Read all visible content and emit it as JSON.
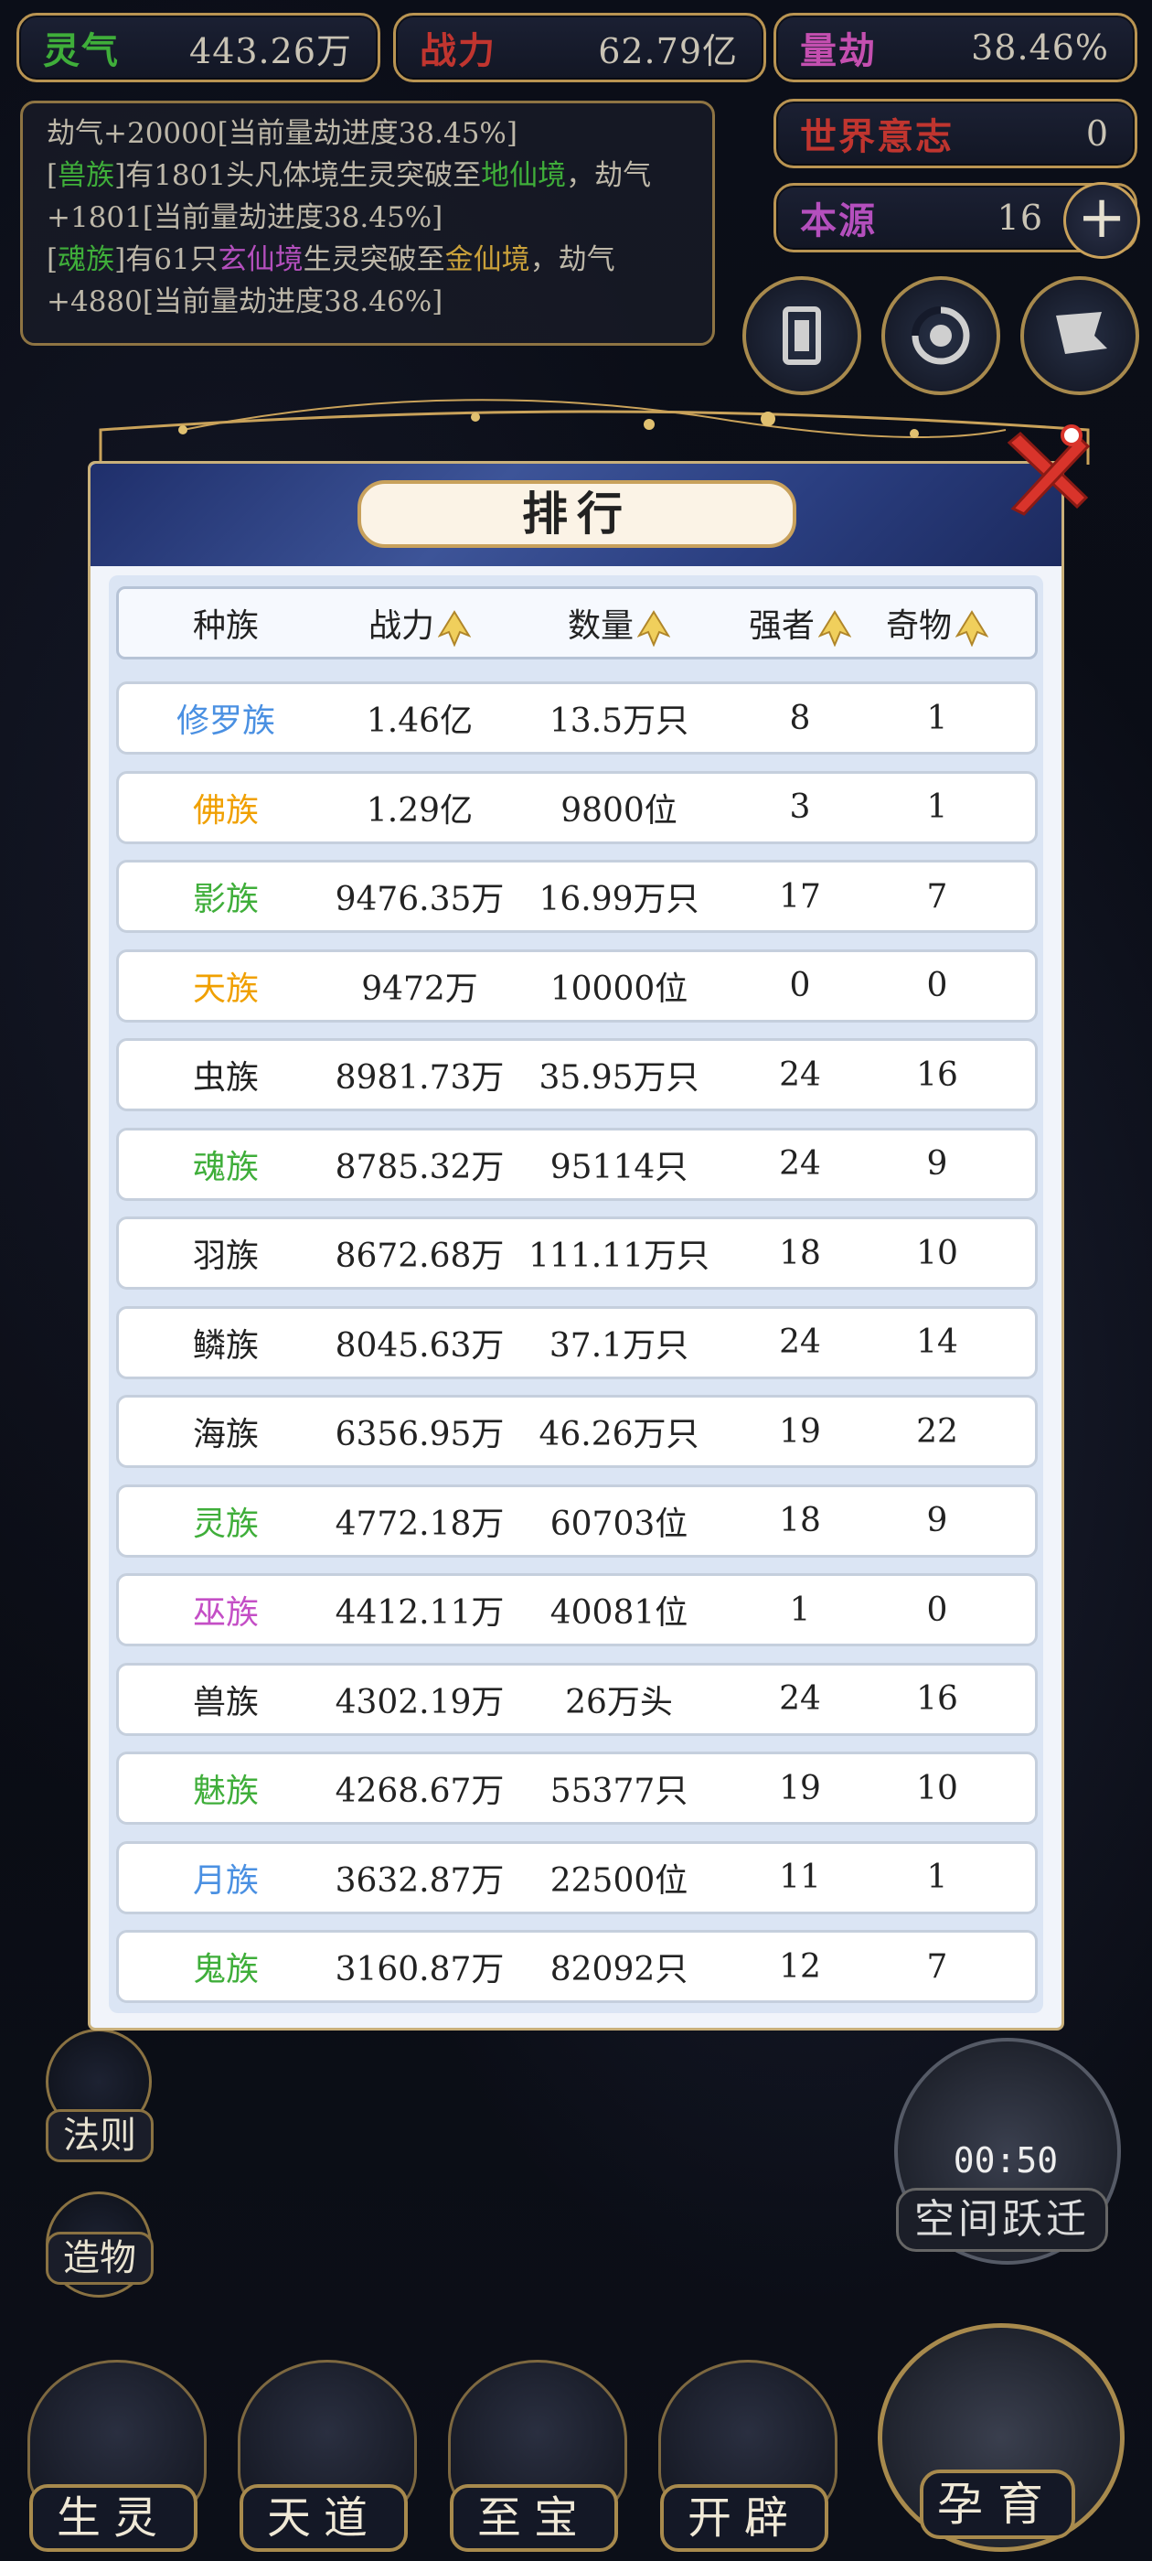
{
  "top": {
    "lingqi": {
      "label": "灵气",
      "value": "443.26万",
      "color": "#3fae3a"
    },
    "zhanli": {
      "label": "战力",
      "value": "62.79亿",
      "color": "#c0352f"
    },
    "liangjie": {
      "label": "量劫",
      "value": "38.46%",
      "color": "#c44fb0"
    },
    "shijie": {
      "label": "世界意志",
      "value": "0",
      "color": "#c0352f"
    },
    "benyuan": {
      "label": "本源",
      "value": "16",
      "color": "#b44fbd"
    }
  },
  "log": {
    "line1": "劫气+20000[当前量劫进度38.45%]",
    "l2_pre": "[",
    "l2_race": "兽族",
    "l2_mid": "]有1801头凡体境生灵突破至",
    "l2_realm": "地仙境",
    "l2_post": "，劫气+1801[当前量劫进度38.45%]",
    "l3_pre": "[",
    "l3_race": "魂族",
    "l3_mid": "]有61只",
    "l3_realm1": "玄仙境",
    "l3_mid2": "生灵突破至",
    "l3_realm2": "金仙境",
    "l3_post": "，劫气+4880[当前量劫进度38.46%]"
  },
  "side": {
    "fa_ze": "法则",
    "zao_wu": "造物",
    "timer": "00:50",
    "kongjian": "空间跃迁"
  },
  "nav": {
    "shengling": "生灵",
    "tiandao": "天道",
    "zhibao": "至宝",
    "kaipi": "开辟",
    "yunyu": "孕育"
  },
  "modal": {
    "title": "排行",
    "headers": {
      "race": "种族",
      "power": "战力",
      "count": "数量",
      "strong": "强者",
      "treasure": "奇物"
    },
    "rows": [
      {
        "race": "修罗族",
        "color": "#4a90e2",
        "power": "1.46亿",
        "count": "13.5万只",
        "strong": "8",
        "treasure": "1"
      },
      {
        "race": "佛族",
        "color": "#f0a000",
        "power": "1.29亿",
        "count": "9800位",
        "strong": "3",
        "treasure": "1"
      },
      {
        "race": "影族",
        "color": "#3fae3a",
        "power": "9476.35万",
        "count": "16.99万只",
        "strong": "17",
        "treasure": "7"
      },
      {
        "race": "天族",
        "color": "#f0a000",
        "power": "9472万",
        "count": "10000位",
        "strong": "0",
        "treasure": "0"
      },
      {
        "race": "虫族",
        "color": "#222222",
        "power": "8981.73万",
        "count": "35.95万只",
        "strong": "24",
        "treasure": "16"
      },
      {
        "race": "魂族",
        "color": "#3fae3a",
        "power": "8785.32万",
        "count": "95114只",
        "strong": "24",
        "treasure": "9"
      },
      {
        "race": "羽族",
        "color": "#222222",
        "power": "8672.68万",
        "count": "111.11万只",
        "strong": "18",
        "treasure": "10"
      },
      {
        "race": "鳞族",
        "color": "#222222",
        "power": "8045.63万",
        "count": "37.1万只",
        "strong": "24",
        "treasure": "14"
      },
      {
        "race": "海族",
        "color": "#222222",
        "power": "6356.95万",
        "count": "46.26万只",
        "strong": "19",
        "treasure": "22"
      },
      {
        "race": "灵族",
        "color": "#3fae3a",
        "power": "4772.18万",
        "count": "60703位",
        "strong": "18",
        "treasure": "9"
      },
      {
        "race": "巫族",
        "color": "#c44fc6",
        "power": "4412.11万",
        "count": "40081位",
        "strong": "1",
        "treasure": "0"
      },
      {
        "race": "兽族",
        "color": "#222222",
        "power": "4302.19万",
        "count": "26万头",
        "strong": "24",
        "treasure": "16"
      },
      {
        "race": "魅族",
        "color": "#3fae3a",
        "power": "4268.67万",
        "count": "55377只",
        "strong": "19",
        "treasure": "10"
      },
      {
        "race": "月族",
        "color": "#4a90e2",
        "power": "3632.87万",
        "count": "22500位",
        "strong": "11",
        "treasure": "1"
      },
      {
        "race": "鬼族",
        "color": "#3fae3a",
        "power": "3160.87万",
        "count": "82092只",
        "strong": "12",
        "treasure": "7"
      }
    ]
  }
}
